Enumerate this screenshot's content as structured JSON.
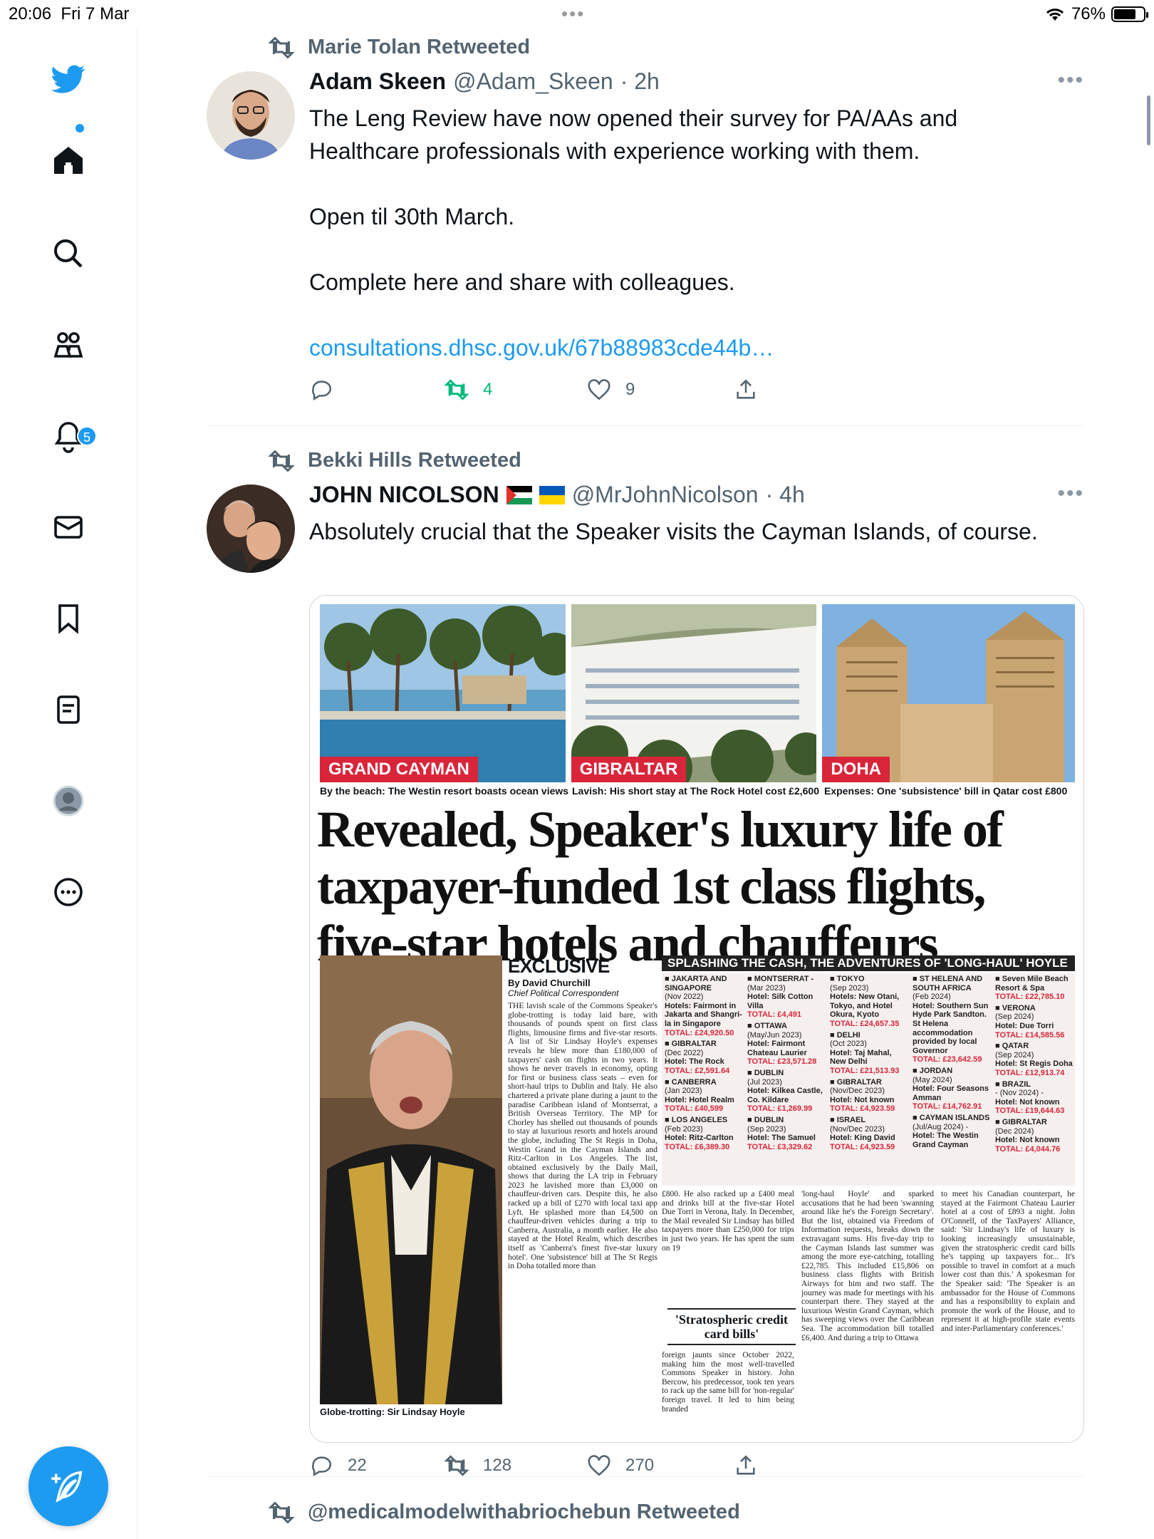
{
  "status_bar": {
    "time": "20:06",
    "date": "Fri 7 Mar",
    "battery": "76%",
    "battery_level": 0.76
  },
  "sidebar": {
    "notifications_badge": "5",
    "items": [
      "twitter-logo",
      "home",
      "search",
      "communities",
      "notifications",
      "messages",
      "bookmarks",
      "lists",
      "profile",
      "more"
    ]
  },
  "tweets": [
    {
      "retweeted_by": "Marie Tolan Retweeted",
      "name": "Adam Skeen",
      "handle": "@Adam_Skeen",
      "time": "· 2h",
      "lines": [
        "The Leng Review have now opened their survey for PA/AAs and Healthcare professionals with experience working with them.",
        "Open til 30th March.",
        "Complete here and share with colleagues."
      ],
      "link": "consultations.dhsc.gov.uk/67b88983cde44b…",
      "replies": "",
      "retweets": "4",
      "likes": "9"
    },
    {
      "retweeted_by": "Bekki Hills Retweeted",
      "name": "JOHN NICOLSON",
      "handle": "@MrJohnNicolson",
      "time": "· 4h",
      "text": "Absolutely crucial that the Speaker visits the Cayman Islands, of course.",
      "replies": "22",
      "retweets": "128",
      "likes": "270"
    },
    {
      "retweeted_by": "@medicalmodelwithabriochebun Retweeted"
    }
  ],
  "article": {
    "photo_tags": [
      "GRAND CAYMAN",
      "GIBRALTAR",
      "DOHA"
    ],
    "captions": [
      "By the beach: The Westin resort boasts ocean views",
      "Lavish: His short stay at The Rock Hotel cost £2,600",
      "Expenses: One 'subsistence' bill in Qatar cost £800"
    ],
    "headline": "Revealed, Speaker's luxury life of taxpayer-funded 1st class flights, five-star hotels and chauffeurs",
    "exclusive": "EXCLUSIVE",
    "byline": "By David Churchill",
    "role": "Chief Political Correspondent",
    "photo_caption": "Globe-trotting: Sir Lindsay Hoyle",
    "band": "SPLASHING THE CASH, THE ADVENTURES OF 'LONG-HAUL' HOYLE",
    "pull_quote": "'Stratospheric credit card bills'",
    "body_col1": "THE lavish scale of the Commons Speaker's globe-trotting is today laid bare, with thousands of pounds spent on first class flights, limousine firms and five-star resorts. A list of Sir Lindsay Hoyle's expenses reveals he blew more than £180,000 of taxpayers' cash on flights in two years. It shows he never travels in economy, opting for first or business class seats – even for short-haul trips to Dublin and Italy. He also chartered a private plane during a jaunt to the paradise Caribbean island of Montserrat, a British Overseas Territory. The MP for Chorley has shelled out thousands of pounds to stay at luxurious resorts and hotels around the globe, including The St Regis in Doha, Westin Grand in the Cayman Islands and Ritz-Carlton in Los Angeles. The list, obtained exclusively by the Daily Mail, shows that during the LA trip in February 2023 he lavished more than £3,000 on chauffeur-driven cars. Despite this, he also racked up a bill of £270 with local taxi app Lyft. He splashed more than £4,500 on chauffeur-driven vehicles during a trip to Canberra, Australia, a month earlier. He also stayed at the Hotel Realm, which describes itself as 'Canberra's finest five-star luxury hotel'. One 'subsistence' bill at The St Regis in Doha totalled more than",
    "body_col2a": "£800. He also racked up a £400 meal and drinks bill at the five-star Hotel Due Torri in Verona, Italy. In December, the Mail revealed Sir Lindsay has billed taxpayers more than £250,000 for trips in just two years. He has spent the sum on 19",
    "body_col2b": "foreign jaunts since October 2022, making him the most well-travelled Commons Speaker in history. John Bercow, his predecessor, took ten years to rack up the same bill for 'non-regular' foreign travel. It led to him being branded",
    "body_col3": "'long-haul Hoyle' and sparked accusations that he had been 'swanning around like he's the Foreign Secretary'. But the list, obtained via Freedom of Information requests, breaks down the extravagant sums. His five-day trip to the Cayman Islands last summer was among the more eye-catching, totalling £22,785. This included £15,806 on business class flights with British Airways for him and two staff. The journey was made for meetings with his counterpart there. They stayed at the luxurious Westin Grand Cayman, which has sweeping views over the Caribbean Sea. The accommodation bill totalled £6,400. And during a trip to Ottawa",
    "body_col4": "to meet his Canadian counterpart, he stayed at the Fairmont Chateau Laurier hotel at a cost of £893 a night. John O'Connell, of the TaxPayers' Alliance, said: 'Sir Lindsay's life of luxury is looking increasingly unsustainable, given the stratospheric credit card bills he's tapping up taxpayers for... It's possible to travel in comfort at a much lower cost than this.' A spokesman for the Speaker said: 'The Speaker is an ambassador for the House of Commons and has a responsibility to explain and promote the work of the House, and to represent it at high-profile state events and inter-Parliamentary conferences.'",
    "trips": [
      [
        {
          "place": "JAKARTA AND SINGAPORE",
          "date": "(Nov 2022)",
          "detail": "Hotels: Fairmont in Jakarta and Shangri-la in Singapore",
          "total": "TOTAL: £24,920.50"
        },
        {
          "place": "GIBRALTAR",
          "date": "(Dec 2022)",
          "detail": "Hotel: The Rock",
          "total": "TOTAL: £2,591.64"
        },
        {
          "place": "CANBERRA",
          "date": "(Jan 2023)",
          "detail": "Hotel: Hotel Realm",
          "total": "TOTAL: £40,599"
        },
        {
          "place": "LOS ANGELES",
          "date": "(Feb 2023)",
          "detail": "Hotel: Ritz-Carlton",
          "total": "TOTAL: £6,389.30"
        }
      ],
      [
        {
          "place": "MONTSERRAT -",
          "date": "(Mar 2023)",
          "detail": "Hotel: Silk Cotton Villa",
          "total": "TOTAL: £4,491"
        },
        {
          "place": "OTTAWA",
          "date": "(May/Jun 2023)",
          "detail": "Hotel: Fairmont Chateau Laurier",
          "total": "TOTAL: £23,571.28"
        },
        {
          "place": "DUBLIN",
          "date": "(Jul 2023)",
          "detail": "Hotel: Kilkea Castle, Co. Kildare",
          "total": "TOTAL: £1,269.99"
        },
        {
          "place": "DUBLIN",
          "date": "(Sep 2023)",
          "detail": "Hotel: The Samuel",
          "total": "TOTAL: £3,329.62"
        }
      ],
      [
        {
          "place": "TOKYO",
          "date": "(Sep 2023)",
          "detail": "Hotels: New Otani, Tokyo, and Hotel Okura, Kyoto",
          "total": "TOTAL: £24,657.35"
        },
        {
          "place": "DELHI",
          "date": "(Oct 2023)",
          "detail": "Hotel: Taj Mahal, New Delhi",
          "total": "TOTAL: £21,513.93"
        },
        {
          "place": "GIBRALTAR",
          "date": "(Nov/Dec 2023)",
          "detail": "Hotel: Not known",
          "total": "TOTAL: £4,923.59"
        },
        {
          "place": "ISRAEL",
          "date": "(Nov/Dec 2023)",
          "detail": "Hotel: King David",
          "total": "TOTAL: £4,923.59"
        }
      ],
      [
        {
          "place": "ST HELENA AND SOUTH AFRICA",
          "date": "(Feb 2024)",
          "detail": "Hotel: Southern Sun Hyde Park Sandton. St Helena accommodation provided by local Governor",
          "total": "TOTAL: £23,642.59"
        },
        {
          "place": "JORDAN",
          "date": "(May 2024)",
          "detail": "Hotel: Four Seasons Amman",
          "total": "TOTAL: £14,762.91"
        },
        {
          "place": "CAYMAN ISLANDS",
          "date": "(Jul/Aug 2024) -",
          "detail": "Hotel: The Westin Grand Cayman",
          "total": ""
        }
      ],
      [
        {
          "place": "Seven Mile Beach Resort & Spa",
          "date": "",
          "detail": "",
          "total": "TOTAL: £22,785.10"
        },
        {
          "place": "VERONA",
          "date": "(Sep 2024)",
          "detail": "Hotel: Due Torri",
          "total": "TOTAL: £14,585.56"
        },
        {
          "place": "QATAR",
          "date": "(Sep 2024)",
          "detail": "Hotel: St Regis Doha",
          "total": "TOTAL: £12,913.74"
        },
        {
          "place": "BRAZIL",
          "date": "- (Nov 2024) -",
          "detail": "Hotel: Not known",
          "total": "TOTAL: £19,644.63"
        },
        {
          "place": "GIBRALTAR",
          "date": "(Dec 2024)",
          "detail": "Hotel: Not known",
          "total": "TOTAL: £4,044.76"
        }
      ]
    ]
  },
  "colors": {
    "accent": "#1d9bf0",
    "retweet_green": "#00ba7c",
    "muted": "#536471",
    "paper_red": "#d9253a"
  }
}
